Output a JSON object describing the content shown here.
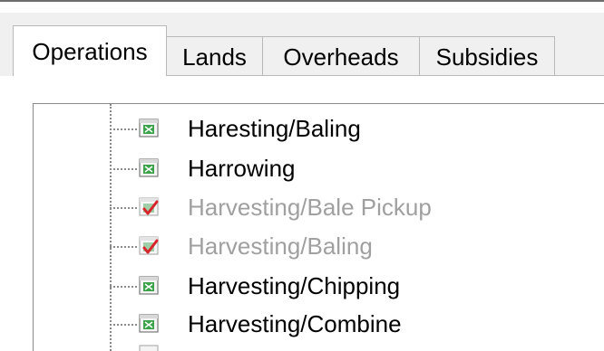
{
  "tabs": [
    {
      "label": "Operations",
      "active": true
    },
    {
      "label": "Lands",
      "active": false
    },
    {
      "label": "Overheads",
      "active": false
    },
    {
      "label": "Subsidies",
      "active": false
    }
  ],
  "tree": {
    "items": [
      {
        "label": "Haresting/Baling",
        "icon": "operation-icon",
        "disabled": false
      },
      {
        "label": "Harrowing",
        "icon": "operation-icon",
        "disabled": false
      },
      {
        "label": "Harvesting/Bale Pickup",
        "icon": "operation-checked-icon",
        "disabled": true
      },
      {
        "label": "Harvesting/Baling",
        "icon": "operation-checked-icon",
        "disabled": true
      },
      {
        "label": "Harvesting/Chipping",
        "icon": "operation-icon",
        "disabled": false
      },
      {
        "label": "Harvesting/Combine",
        "icon": "operation-icon",
        "disabled": false
      }
    ]
  },
  "colors": {
    "tab_background": "#f0f0f0",
    "disabled_text": "#a0a0a0",
    "icon_green": "#3aa34a",
    "check_red": "#d7262b"
  }
}
